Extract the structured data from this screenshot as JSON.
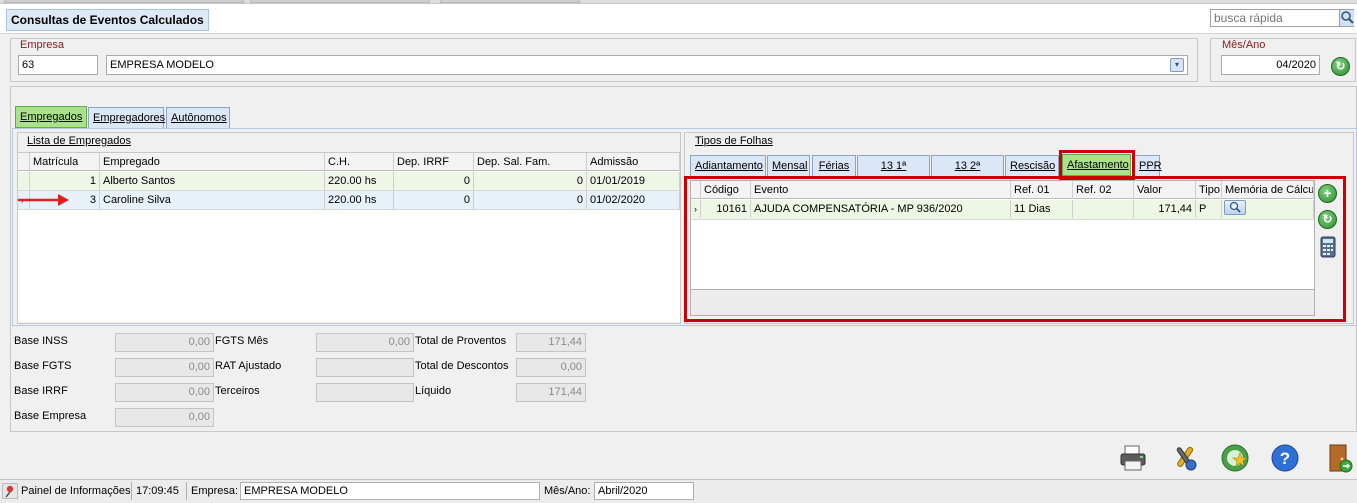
{
  "window": {
    "title": "Consultas de Eventos Calculados"
  },
  "search": {
    "placeholder": "busca rápida"
  },
  "empresa": {
    "label": "Empresa",
    "code": "63",
    "name": "EMPRESA MODELO"
  },
  "mes_ano": {
    "label": "Mês/Ano",
    "value": "04/2020"
  },
  "left_tabs": [
    "Empregados",
    "Empregadores",
    "Autônomos"
  ],
  "lista": {
    "title": "Lista de Empregados",
    "columns": [
      "Matrícula",
      "Empregado",
      "C.H.",
      "Dep. IRRF",
      "Dep. Sal. Fam.",
      "Admissão"
    ],
    "rows": [
      {
        "matricula": "1",
        "empregado": "Alberto Santos",
        "ch": "220.00 hs",
        "dep_irrf": "0",
        "dep_sal_fam": "0",
        "admissao": "01/01/2019"
      },
      {
        "matricula": "3",
        "empregado": "Caroline Silva",
        "ch": "220.00 hs",
        "dep_irrf": "0",
        "dep_sal_fam": "0",
        "admissao": "01/02/2020"
      }
    ]
  },
  "tipos": {
    "title": "Tipos de Folhas",
    "tabs": [
      "Adiantamento",
      "Mensal",
      "Férias",
      "13 1ª Parcela",
      "13 2ª Parcela",
      "Rescisão",
      "Afastamento",
      "PPR"
    ],
    "columns": [
      "Código",
      "Evento",
      "Ref. 01",
      "Ref. 02",
      "Valor",
      "Tipo",
      "Memória de Cálcul"
    ],
    "rows": [
      {
        "codigo": "10161",
        "evento": "AJUDA COMPENSATÓRIA - MP 936/2020",
        "ref01": "11 Dias",
        "ref02": "",
        "valor": "171,44",
        "tipo": "P"
      }
    ]
  },
  "totais": {
    "base_inss": {
      "label": "Base INSS",
      "value": "0,00"
    },
    "base_fgts": {
      "label": "Base FGTS",
      "value": "0,00"
    },
    "base_irrf": {
      "label": "Base IRRF",
      "value": "0,00"
    },
    "base_empresa": {
      "label": "Base Empresa",
      "value": "0,00"
    },
    "fgts_mes": {
      "label": "FGTS Mês",
      "value": "0,00"
    },
    "rat_ajustado": {
      "label": "RAT Ajustado",
      "value": ""
    },
    "terceiros": {
      "label": "Terceiros",
      "value": ""
    },
    "total_proventos": {
      "label": "Total de Proventos",
      "value": "171,44"
    },
    "total_descontos": {
      "label": "Total de Descontos",
      "value": "0,00"
    },
    "liquido": {
      "label": "Líquido",
      "value": "171,44"
    }
  },
  "status": {
    "painel": "Painel de Informações",
    "time": "17:09:45",
    "empresa_label": "Empresa:",
    "empresa_value": "EMPRESA MODELO",
    "mes_label": "Mês/Ano:",
    "mes_value": "Abril/2020"
  },
  "colors": {
    "accent_red": "#cc0000",
    "active_tab": "#a9e28a",
    "tab": "#dbe7f6"
  }
}
